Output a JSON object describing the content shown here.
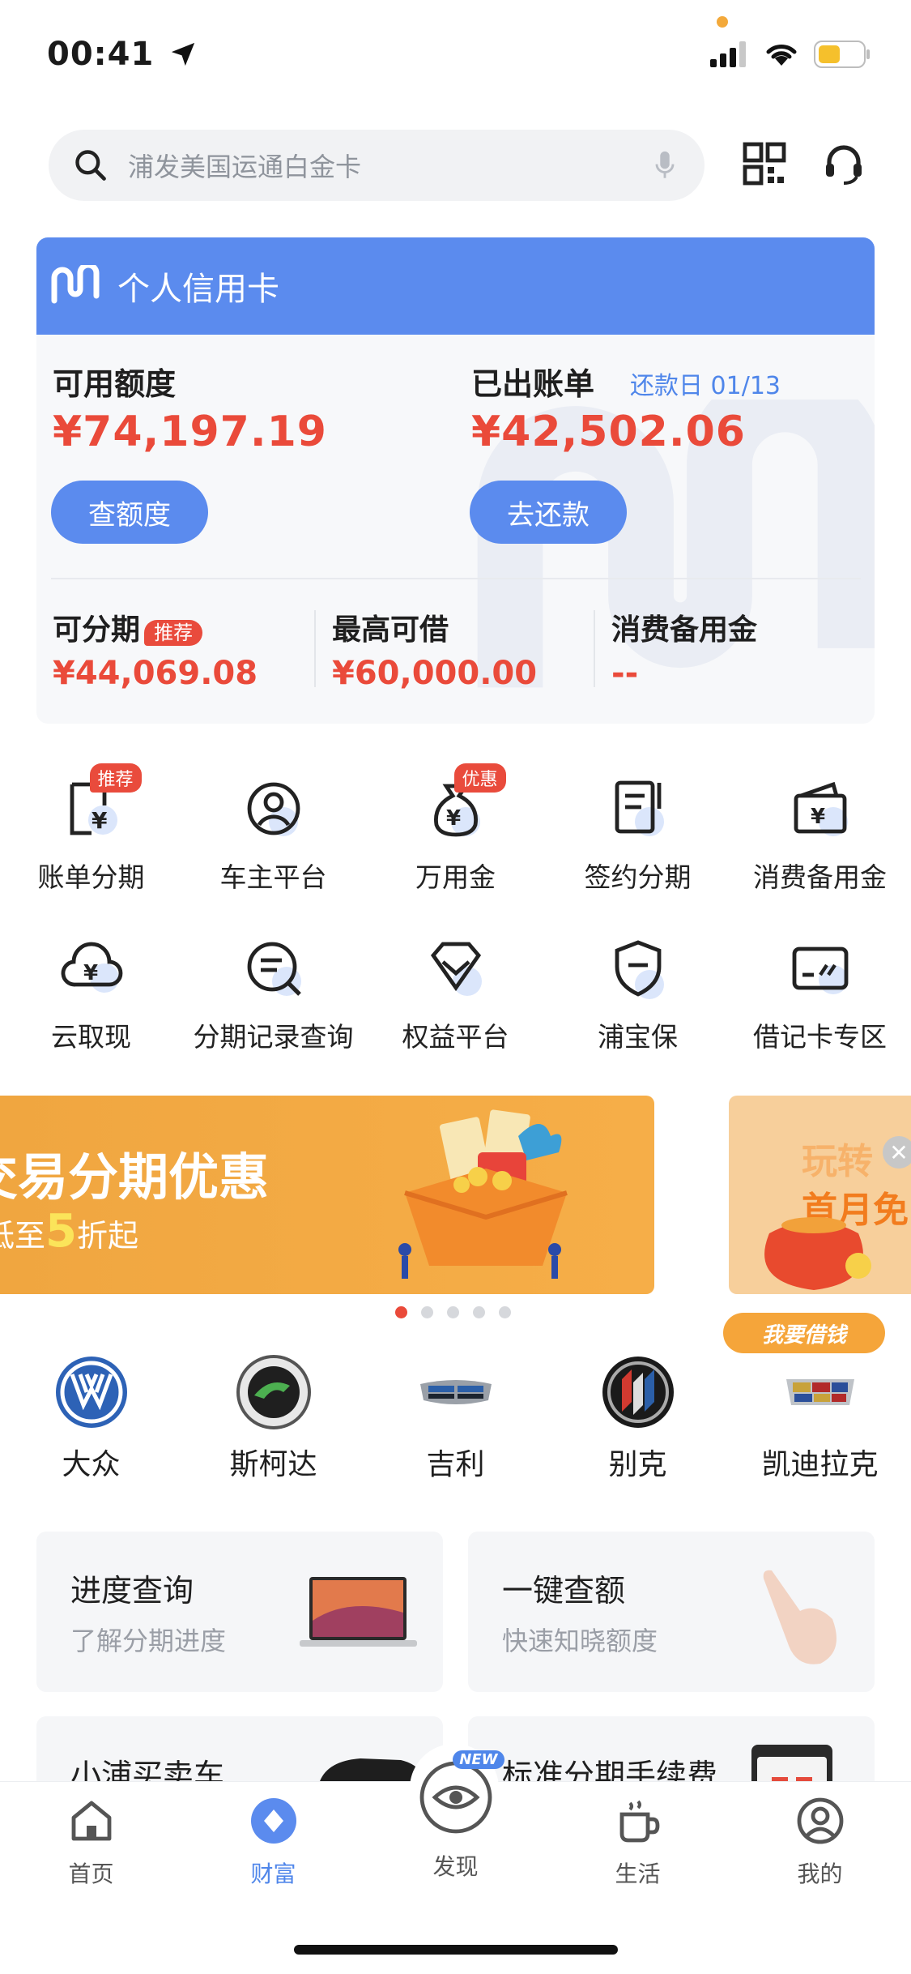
{
  "status": {
    "time": "00:41"
  },
  "search": {
    "placeholder": "浦发美国运通白金卡"
  },
  "card": {
    "title": "个人信用卡",
    "available_label": "可用额度",
    "available_amount": "¥74,197.19",
    "check_limit_button": "查额度",
    "bill_label": "已出账单",
    "due_date": "还款日 01/13",
    "bill_amount": "¥42,502.06",
    "repay_button": "去还款",
    "installment_label": "可分期",
    "installment_tag": "推荐",
    "installment_amount": "¥44,069.08",
    "max_borrow_label": "最高可借",
    "max_borrow_amount": "¥60,000.00",
    "reserve_label": "消费备用金",
    "reserve_amount": "--"
  },
  "grid": [
    {
      "label": "账单分期",
      "icon": "bill-installment-icon",
      "badge": "推荐"
    },
    {
      "label": "车主平台",
      "icon": "car-owner-icon",
      "badge": ""
    },
    {
      "label": "万用金",
      "icon": "money-bag-icon",
      "badge": "优惠"
    },
    {
      "label": "签约分期",
      "icon": "contract-installment-icon",
      "badge": ""
    },
    {
      "label": "消费备用金",
      "icon": "wallet-icon",
      "badge": ""
    },
    {
      "label": "云取现",
      "icon": "cloud-cash-icon",
      "badge": ""
    },
    {
      "label": "分期记录查询",
      "icon": "record-search-icon",
      "badge": ""
    },
    {
      "label": "权益平台",
      "icon": "diamond-icon",
      "badge": ""
    },
    {
      "label": "浦宝保",
      "icon": "shield-icon",
      "badge": ""
    },
    {
      "label": "借记卡专区",
      "icon": "debit-card-icon",
      "badge": ""
    }
  ],
  "banner": {
    "title": "交易分期优惠",
    "sub_prefix": "低至",
    "sub_number": "5",
    "sub_suffix": "折起"
  },
  "side_ad": {
    "title_line1": "玩转",
    "title_line2": "首月免",
    "button": "我要借钱"
  },
  "carousel": {
    "count": 5,
    "active": 0
  },
  "brands": [
    {
      "label": "大众",
      "icon": "volkswagen-logo-icon"
    },
    {
      "label": "斯柯达",
      "icon": "skoda-logo-icon"
    },
    {
      "label": "吉利",
      "icon": "geely-logo-icon"
    },
    {
      "label": "别克",
      "icon": "buick-logo-icon"
    },
    {
      "label": "凯迪拉克",
      "icon": "cadillac-logo-icon"
    }
  ],
  "info_cards": [
    {
      "title": "进度查询",
      "sub": "了解分期进度"
    },
    {
      "title": "一键查额",
      "sub": "快速知晓额度"
    },
    {
      "title": "小浦买卖车",
      "sub": ""
    },
    {
      "title": "标准分期手续费",
      "sub": ""
    }
  ],
  "tabs": [
    {
      "label": "首页",
      "icon": "home-icon"
    },
    {
      "label": "财富",
      "icon": "wealth-icon"
    },
    {
      "label": "发现",
      "icon": "discover-icon",
      "badge": "NEW"
    },
    {
      "label": "生活",
      "icon": "coffee-cup-icon"
    },
    {
      "label": "我的",
      "icon": "profile-icon"
    }
  ],
  "colors": {
    "accent": "#5b8bee",
    "amount_red": "#ea4a3a",
    "banner_orange": "#f0a640"
  }
}
